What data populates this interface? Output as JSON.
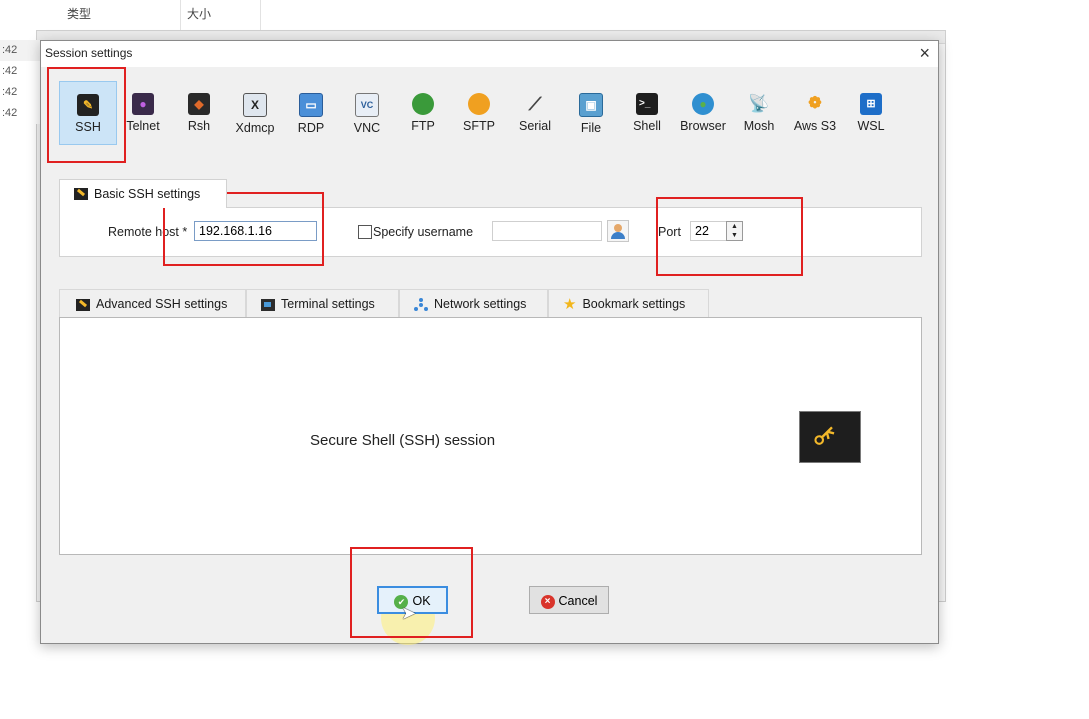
{
  "background": {
    "columns": [
      "类型",
      "大小"
    ],
    "times": [
      ":42",
      ":42",
      ":42",
      ":42"
    ]
  },
  "dialog": {
    "title": "Session settings",
    "close": "×"
  },
  "toolbar": [
    {
      "label": "SSH",
      "icon": "ssh-icon",
      "selected": true
    },
    {
      "label": "Telnet",
      "icon": "telnet-icon"
    },
    {
      "label": "Rsh",
      "icon": "rsh-icon"
    },
    {
      "label": "Xdmcp",
      "icon": "xdmcp-icon"
    },
    {
      "label": "RDP",
      "icon": "rdp-icon"
    },
    {
      "label": "VNC",
      "icon": "vnc-icon"
    },
    {
      "label": "FTP",
      "icon": "ftp-icon"
    },
    {
      "label": "SFTP",
      "icon": "sftp-icon"
    },
    {
      "label": "Serial",
      "icon": "serial-icon"
    },
    {
      "label": "File",
      "icon": "file-icon"
    },
    {
      "label": "Shell",
      "icon": "shell-icon"
    },
    {
      "label": "Browser",
      "icon": "browser-icon"
    },
    {
      "label": "Mosh",
      "icon": "mosh-icon"
    },
    {
      "label": "Aws S3",
      "icon": "aws-s3-icon"
    },
    {
      "label": "WSL",
      "icon": "wsl-icon"
    }
  ],
  "basic": {
    "tab_label": "Basic SSH settings",
    "remote_host_label": "Remote host *",
    "remote_host_value": "192.168.1.16",
    "specify_username_label": "Specify username",
    "specify_username_checked": false,
    "username_value": "",
    "port_label": "Port",
    "port_value": "22"
  },
  "tabs": [
    {
      "label": "Advanced SSH settings",
      "icon": "ssh-icon"
    },
    {
      "label": "Terminal settings",
      "icon": "terminal-icon"
    },
    {
      "label": "Network settings",
      "icon": "network-icon"
    },
    {
      "label": "Bookmark settings",
      "icon": "star-icon"
    }
  ],
  "content": {
    "description": "Secure Shell (SSH) session",
    "icon": "key-icon"
  },
  "buttons": {
    "ok": "OK",
    "cancel": "Cancel"
  },
  "colors": {
    "annotation_red": "#e02020",
    "selected_bg": "#cce4f7",
    "ok_border": "#3b8de0"
  }
}
